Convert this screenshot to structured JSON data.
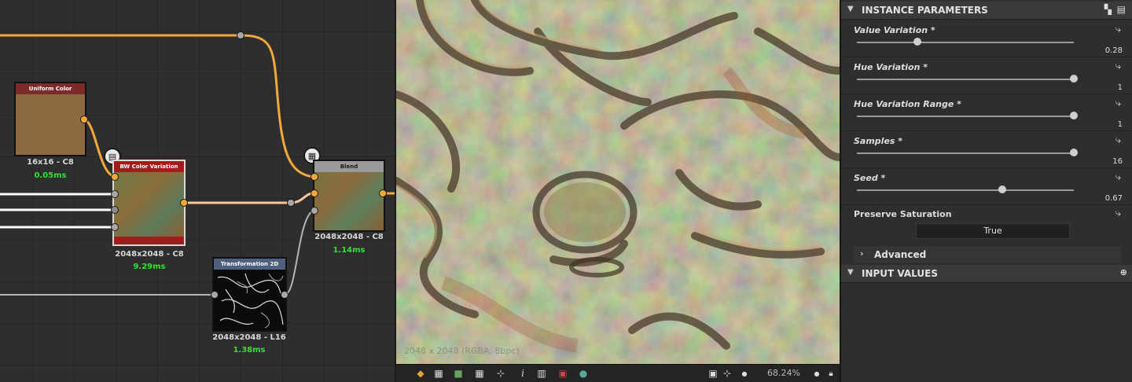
{
  "graph": {
    "nodes": {
      "uniform": {
        "title": "Uniform Color",
        "res": "16x16 - C8",
        "time": "0.05ms"
      },
      "bw": {
        "title": "BW Color Variation",
        "res": "2048x2048 - C8",
        "time": "9.29ms"
      },
      "blend": {
        "title": "Blend",
        "res": "2048x2048 - C8",
        "time": "1.14ms"
      },
      "transform": {
        "title": "Transformation 2D",
        "res": "2048x2048 - L16",
        "time": "1.38ms"
      }
    },
    "colors": {
      "wire_orange": "#f2a93b",
      "wire_light": "#f5c79a",
      "wire_white": "#ffffff",
      "wire_gray": "#b5b5b5",
      "time_green": "#35e035"
    }
  },
  "viewport": {
    "info": "2048 x 2048 (RGBA, 8bpc)",
    "zoom": "68.24%",
    "toolbar_icons": [
      "layers-icon",
      "checker-icon",
      "channels-icon",
      "grid-icon",
      "tiling-icon",
      "info-icon",
      "histogram-icon",
      "display-icon",
      "color-wheel-icon"
    ],
    "right_icons": [
      "fit-icon",
      "zoom-icon",
      "zoom-slider-icon",
      "lock-icon"
    ]
  },
  "panel": {
    "instance_header": "INSTANCE PARAMETERS",
    "params": [
      {
        "label": "Value Variation *",
        "value": "0.28",
        "fraction": 0.28
      },
      {
        "label": "Hue Variation *",
        "value": "1",
        "fraction": 1.0
      },
      {
        "label": "Hue Variation Range *",
        "value": "1",
        "fraction": 1.0
      },
      {
        "label": "Samples *",
        "value": "16",
        "fraction": 1.0
      },
      {
        "label": "Seed *",
        "value": "0.67",
        "fraction": 0.67
      }
    ],
    "preserve_label": "Preserve Saturation",
    "preserve_value": "True",
    "advanced_label": "Advanced",
    "input_header": "INPUT VALUES"
  }
}
